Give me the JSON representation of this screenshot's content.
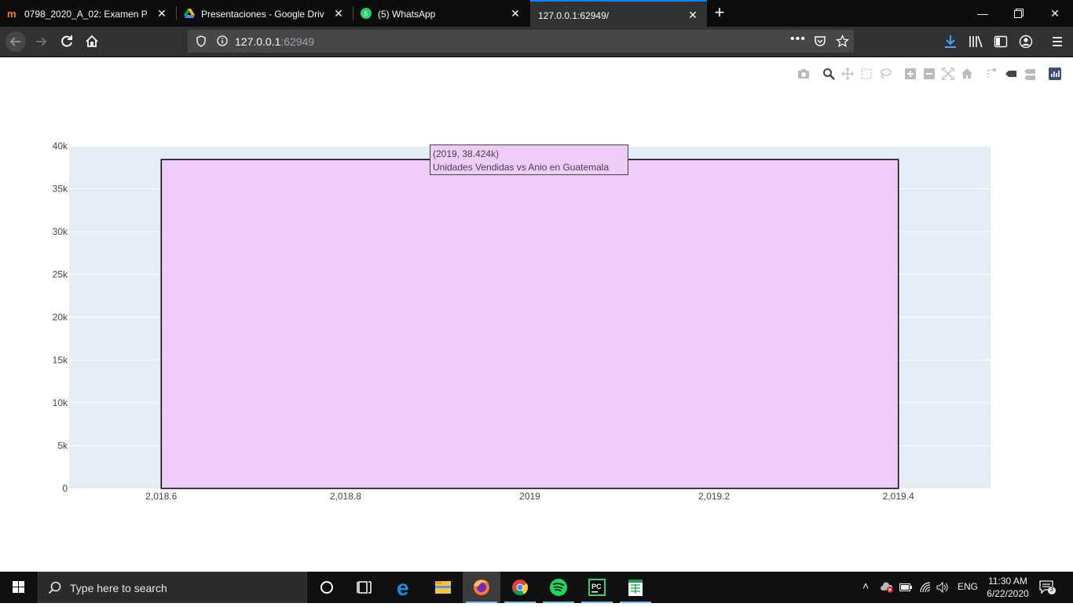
{
  "browser": {
    "tabs": [
      {
        "title": "0798_2020_A_02: Examen Parcial",
        "icon": "moodle-icon",
        "active": false
      },
      {
        "title": "Presentaciones - Google Drive",
        "icon": "google-drive-icon",
        "active": false
      },
      {
        "title": "(5) WhatsApp",
        "icon": "whatsapp-icon",
        "active": false,
        "badge": "5"
      },
      {
        "title": "127.0.0.1:62949/",
        "icon": "",
        "active": true
      }
    ],
    "new_tab_label": "+",
    "url": {
      "host": "127.0.0.1",
      "port": ":62949"
    }
  },
  "modebar": {
    "icons": [
      "camera-icon",
      "zoom-icon",
      "pan-icon",
      "box-select-icon",
      "lasso-select-icon",
      "zoom-in-icon",
      "zoom-out-icon",
      "autoscale-icon",
      "reset-axes-icon",
      "spike-lines-icon",
      "hover-closest-icon",
      "hover-compare-icon",
      "plotly-logo-icon"
    ]
  },
  "chart_data": {
    "type": "bar",
    "x": [
      2019
    ],
    "values": [
      38424
    ],
    "bar_color": "#efcbf8",
    "bar_outline": "#000000",
    "plot_bg": "#e5ecf6",
    "xlim": [
      2018.5,
      2019.5
    ],
    "ylim": [
      0,
      40000
    ],
    "x_ticks": [
      "2,018.6",
      "2,018.8",
      "2019",
      "2,019.2",
      "2,019.4"
    ],
    "y_ticks": [
      "0",
      "5k",
      "10k",
      "15k",
      "20k",
      "25k",
      "30k",
      "35k",
      "40k"
    ],
    "grid": true,
    "title": "",
    "xlabel": "",
    "ylabel": "",
    "hover": {
      "line1": "(2019, 38.424k)",
      "line2": "Unidades Vendidas vs Anio en Guatemala"
    }
  },
  "taskbar": {
    "search_placeholder": "Type here to search",
    "apps": [
      "cortana-icon",
      "task-view-icon",
      "edge-icon",
      "file-explorer-icon",
      "firefox-icon",
      "chrome-icon",
      "spotify-icon",
      "pycharm-icon",
      "excel-icon"
    ],
    "language": "ENG",
    "time": "11:30 AM",
    "date": "6/22/2020",
    "notifications": "3"
  }
}
